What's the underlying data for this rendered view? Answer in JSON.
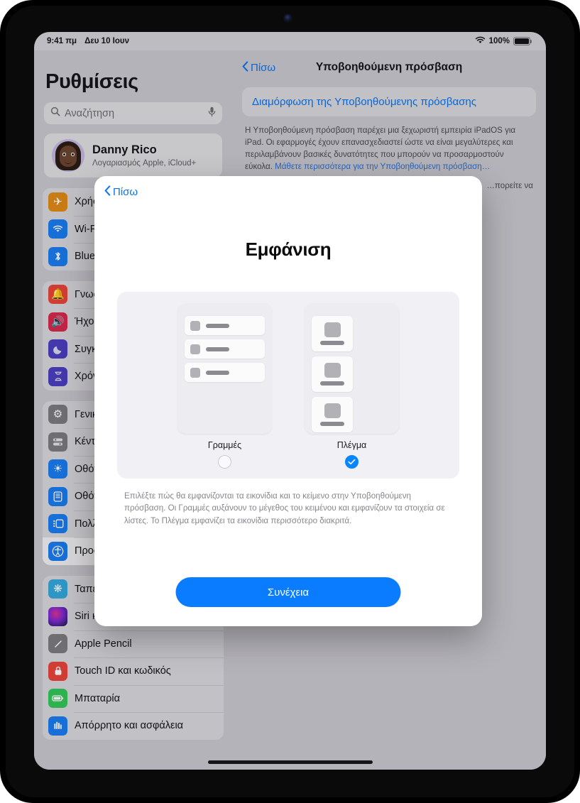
{
  "status_bar": {
    "time": "9:41 πμ",
    "date": "Δευ 10 Ιουν",
    "battery_percent": "100%",
    "wifi_icon": "wifi-icon",
    "battery_icon": "battery-full-icon"
  },
  "sidebar": {
    "title": "Ρυθμίσεις",
    "search": {
      "placeholder": "Αναζήτηση",
      "value": "",
      "icon": "search-icon",
      "mic_icon": "microphone-icon"
    },
    "profile": {
      "name": "Danny Rico",
      "subtitle": "Λογαριασμός Apple, iCloud+",
      "avatar": "memoji-avatar"
    },
    "groups": [
      {
        "items": [
          {
            "label": "Χρήση σε πτήση",
            "icon": "airplane-icon",
            "color": "#e08b18",
            "selected": false
          },
          {
            "label": "Wi-Fi",
            "icon": "wifi-icon",
            "color": "#1a7cf0",
            "selected": false
          },
          {
            "label": "Bluetooth",
            "icon": "bluetooth-icon",
            "color": "#1a7cf0",
            "selected": false
          }
        ]
      },
      {
        "items": [
          {
            "label": "Γνωστοποιήσεις",
            "icon": "bell-icon",
            "color": "#e8443a",
            "selected": false
          },
          {
            "label": "Ήχοι",
            "icon": "speaker-icon",
            "color": "#d62a4e",
            "selected": false
          },
          {
            "label": "Συγκέντρωση",
            "icon": "moon-icon",
            "color": "#4b3fc0",
            "selected": false
          },
          {
            "label": "Χρόνος επί οθόνης",
            "icon": "hourglass-icon",
            "color": "#4b3fc0",
            "selected": false
          }
        ]
      },
      {
        "items": [
          {
            "label": "Γενικά",
            "icon": "gear-icon",
            "color": "#7b7b80",
            "selected": false
          },
          {
            "label": "Κέντρο ελέγχου",
            "icon": "sliders-icon",
            "color": "#7b7b80",
            "selected": false
          },
          {
            "label": "Οθόνη και φωτεινότητα",
            "icon": "brightness-icon",
            "color": "#1a7cf0",
            "selected": false
          },
          {
            "label": "Οθόνη Αφετηρίας",
            "icon": "home-screen-icon",
            "color": "#1a7cf0",
            "selected": false
          },
          {
            "label": "Πολλαπλές εργασίες",
            "icon": "multitasking-icon",
            "color": "#1a7cf0",
            "selected": false
          },
          {
            "label": "Προσβασιμότητα",
            "icon": "accessibility-icon",
            "color": "#1a7cf0",
            "selected": true
          }
        ]
      },
      {
        "items": [
          {
            "label": "Ταπετσαρία",
            "icon": "wallpaper-icon",
            "color": "#35a8dd",
            "selected": false
          },
          {
            "label": "Siri και Αναζήτηση",
            "icon": "siri-icon",
            "color": "#1b1b22",
            "selected": false
          },
          {
            "label": "Apple Pencil",
            "icon": "pencil-icon",
            "color": "#7b7b80",
            "selected": false
          },
          {
            "label": "Touch ID και κωδικός",
            "icon": "lock-icon",
            "color": "#e8443a",
            "selected": false
          },
          {
            "label": "Μπαταρία",
            "icon": "battery-icon",
            "color": "#34c759",
            "selected": false
          },
          {
            "label": "Απόρρητο και ασφάλεια",
            "icon": "privacy-hand-icon",
            "color": "#1a7cf0",
            "selected": false
          }
        ]
      }
    ]
  },
  "detail": {
    "back_label": "Πίσω",
    "back_icon": "chevron-left-icon",
    "title": "Υποβοηθούμενη πρόσβαση",
    "link_card_label": "Διαμόρφωση της Υποβοηθούμενης πρόσβασης",
    "body_text": "Η Υποβοηθούμενη πρόσβαση παρέχει μια ξεχωριστή εμπειρία iPadOS για iPad. Οι εφαρμογές έχουν επανασχεδιαστεί ώστε να είναι μεγαλύτερες και περιλαμβάνουν βασικές δυνατότητες που μπορούν να προσαρμοστούν εύκολα. ",
    "body_link": "Μάθετε περισσότερα για την Υποβοηθούμενη πρόσβαση…",
    "body_text_2": "…πορείτε να"
  },
  "modal": {
    "back_label": "Πίσω",
    "back_icon": "chevron-left-icon",
    "title": "Εμφάνιση",
    "options": [
      {
        "label": "Γραμμές",
        "type": "rows",
        "selected": false
      },
      {
        "label": "Πλέγμα",
        "type": "grid",
        "selected": true
      }
    ],
    "description": "Επιλέξτε πώς θα εμφανίζονται τα εικονίδια και το κείμενο στην Υποβοηθούμενη πρόσβαση. Οι Γραμμές αυξάνουν το μέγεθος του κειμένου και εμφανίζουν τα στοιχεία σε λίστες. Το Πλέγμα εμφανίζει τα εικονίδια περισσότερο διακριτά.",
    "continue_label": "Συνέχεια",
    "check_icon": "checkmark-icon"
  },
  "colors": {
    "accent": "#0a7cff",
    "link": "#0a72ee",
    "selected_check": "#0a84ff"
  }
}
